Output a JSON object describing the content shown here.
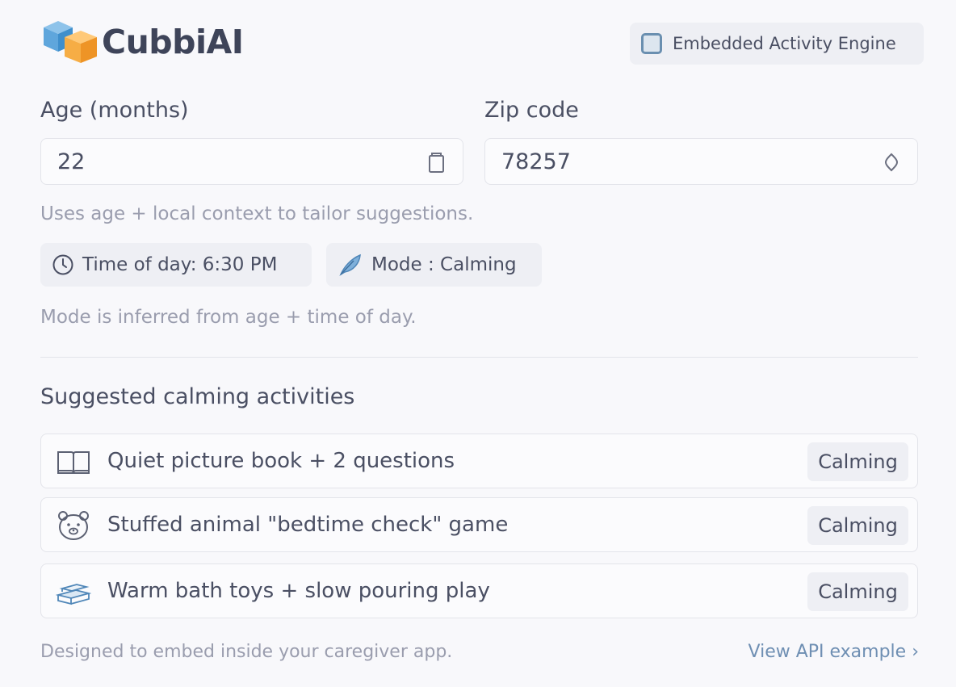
{
  "brand": {
    "name": "CubbiAI"
  },
  "badge": {
    "label": "Embedded Activity Engine"
  },
  "age": {
    "label": "Age (months)",
    "value": "22"
  },
  "zip": {
    "label": "Zip code",
    "value": "78257"
  },
  "context_hint": "Uses age + local context to tailor suggestions.",
  "chips": {
    "time": "Time of day: 6:30 PM",
    "mode": "Mode : Calming"
  },
  "mode_hint": "Mode is inferred from age + time of day.",
  "suggestions": {
    "title": "Suggested calming activities",
    "items": [
      {
        "icon": "book-icon",
        "label": "Quiet picture book + 2 questions",
        "tag": "Calming"
      },
      {
        "icon": "teddy-bear-icon",
        "label": "Stuffed animal \"bedtime check\" game",
        "tag": "Calming"
      },
      {
        "icon": "bath-toys-icon",
        "label": "Warm bath toys + slow pouring play",
        "tag": "Calming"
      }
    ]
  },
  "footer": {
    "note": "Designed to embed inside your caregiver app.",
    "link": "View API example ›"
  },
  "colors": {
    "accent_blue": "#6a9fd0",
    "accent_orange": "#f5a53a",
    "link": "#6f8fb3"
  }
}
